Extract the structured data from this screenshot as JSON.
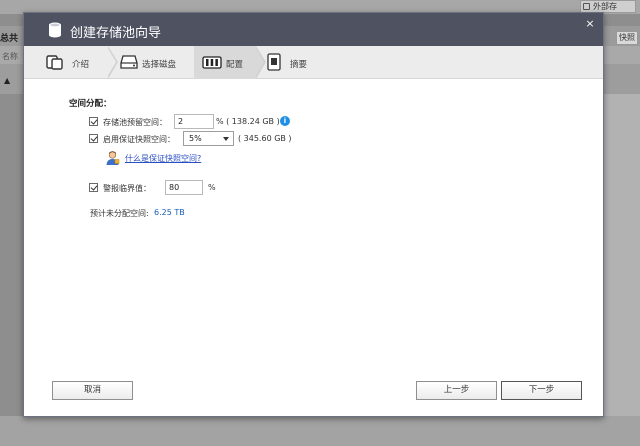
{
  "background": {
    "total_label": "总共",
    "name_label": "名称",
    "external_label": "外部存",
    "right_button": "快照"
  },
  "dialog": {
    "title": "创建存储池向导",
    "close_glyph": "×"
  },
  "steps": [
    {
      "label": "介绍",
      "icon": "intro-icon",
      "active": false
    },
    {
      "label": "选择磁盘",
      "icon": "disk-icon",
      "active": false
    },
    {
      "label": "配置",
      "icon": "configure-icon",
      "active": true
    },
    {
      "label": "摘要",
      "icon": "summary-icon",
      "active": false
    }
  ],
  "config": {
    "section_title": "空间分配：",
    "reserve_space": {
      "label": "存储池预留空间：",
      "value": "2",
      "suffix": "% ( 138.24 GB )",
      "checked": true
    },
    "guaranteed_snapshot": {
      "label": "启用保证快照空间：",
      "selected": "5%",
      "suffix": "( 345.60 GB )",
      "checked": true
    },
    "help_link": "什么是保证快照空间?",
    "alert_threshold": {
      "label": "警报临界值：",
      "value": "80",
      "suffix": "%",
      "checked": true
    },
    "unallocated": {
      "label": "预计未分配空间:",
      "value": "6.25 TB"
    }
  },
  "footer": {
    "cancel": "取消",
    "back": "上一步",
    "next": "下一步"
  },
  "colors": {
    "titlebar": "#4e5261",
    "info_blue": "#1f8fe6",
    "link_blue": "#2b4fc2",
    "value_blue": "#1b5fb8"
  }
}
